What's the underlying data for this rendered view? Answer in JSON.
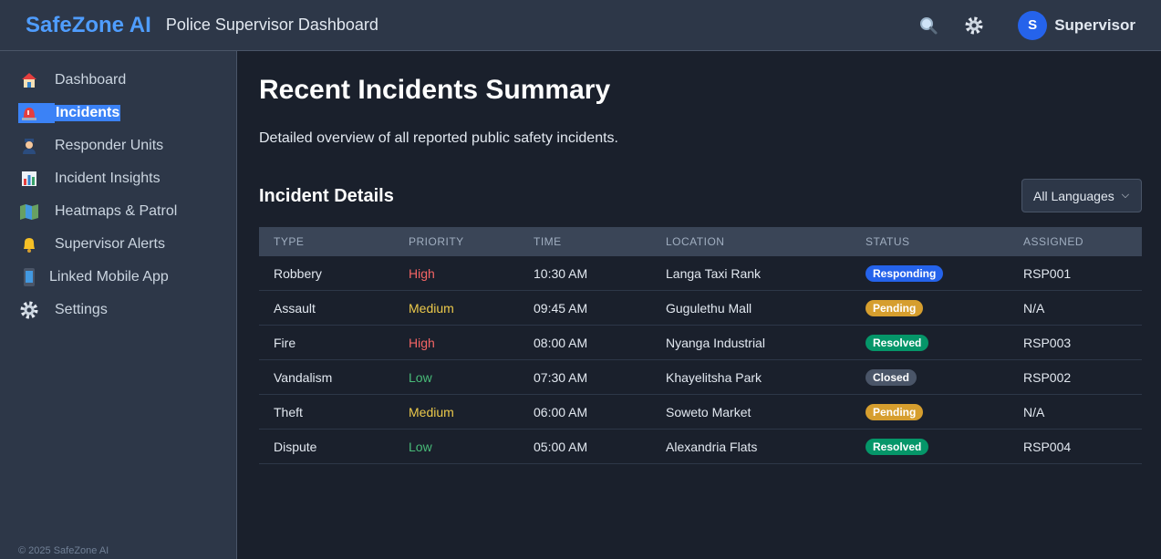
{
  "topbar": {
    "brand": "SafeZone AI",
    "title": "Police Supervisor Dashboard",
    "avatar_initial": "S",
    "user_name": "Supervisor"
  },
  "sidebar": {
    "items": [
      {
        "label": "Dashboard",
        "icon": "house-icon"
      },
      {
        "label": "Incidents",
        "icon": "siren-icon"
      },
      {
        "label": "Responder Units",
        "icon": "police-officer-icon"
      },
      {
        "label": "Incident Insights",
        "icon": "bar-chart-icon"
      },
      {
        "label": "Heatmaps & Patrol",
        "icon": "map-icon"
      },
      {
        "label": "Supervisor Alerts",
        "icon": "bell-icon"
      },
      {
        "label": "Linked Mobile App",
        "icon": "mobile-phone-icon"
      },
      {
        "label": "Settings",
        "icon": "gear-icon"
      }
    ],
    "footer": "© 2025 SafeZone AI"
  },
  "main": {
    "title": "Recent Incidents Summary",
    "description": "Detailed overview of all reported public safety incidents.",
    "section_title": "Incident Details",
    "language_select": "All Languages",
    "columns": [
      "TYPE",
      "PRIORITY",
      "TIME",
      "LOCATION",
      "STATUS",
      "ASSIGNED"
    ],
    "rows": [
      {
        "type": "Robbery",
        "priority": "High",
        "time": "10:30 AM",
        "location": "Langa Taxi Rank",
        "status": "Responding",
        "assigned": "RSP001"
      },
      {
        "type": "Assault",
        "priority": "Medium",
        "time": "09:45 AM",
        "location": "Gugulethu Mall",
        "status": "Pending",
        "assigned": "N/A"
      },
      {
        "type": "Fire",
        "priority": "High",
        "time": "08:00 AM",
        "location": "Nyanga Industrial",
        "status": "Resolved",
        "assigned": "RSP003"
      },
      {
        "type": "Vandalism",
        "priority": "Low",
        "time": "07:30 AM",
        "location": "Khayelitsha Park",
        "status": "Closed",
        "assigned": "RSP002"
      },
      {
        "type": "Theft",
        "priority": "Medium",
        "time": "06:00 AM",
        "location": "Soweto Market",
        "status": "Pending",
        "assigned": "N/A"
      },
      {
        "type": "Dispute",
        "priority": "Low",
        "time": "05:00 AM",
        "location": "Alexandria Flats",
        "status": "Resolved",
        "assigned": "RSP004"
      }
    ]
  },
  "colors": {
    "priority": {
      "High": "#f56565",
      "Medium": "#ecc94b",
      "Low": "#48bb78"
    },
    "status": {
      "Responding": "#2563eb",
      "Pending": "#d69e2e",
      "Resolved": "#059669",
      "Closed": "#4a5568"
    }
  }
}
